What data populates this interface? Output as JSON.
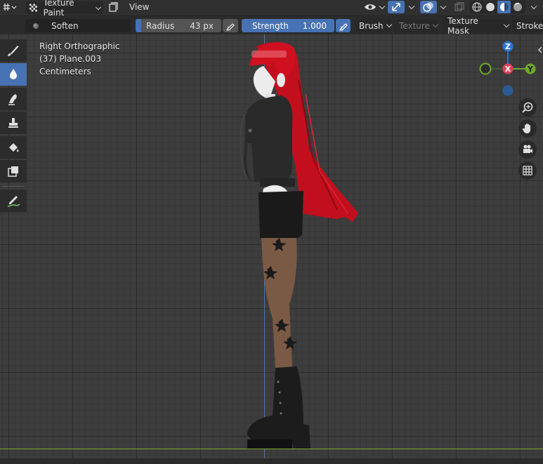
{
  "header": {
    "mode_label": "Texture Paint",
    "view_menu": "View",
    "colors": {
      "accent": "#4772b3",
      "header_bg": "#303030"
    },
    "icons": [
      "editor-type-icon",
      "texture-paint-icon",
      "view-toggle-icon",
      "visibility-icon",
      "gizmo-icon",
      "overlay-icon",
      "xray-icon",
      "shading-wireframe-icon",
      "shading-solid-icon",
      "shading-material-icon",
      "shading-rendered-icon"
    ]
  },
  "tool_settings": {
    "brush_name": "Soften",
    "radius_label": "Radius",
    "radius_value": "43 px",
    "strength_label": "Strength",
    "strength_value": "1.000",
    "brush_menu": "Brush",
    "texture_menu": "Texture",
    "texture_mask_menu": "Texture Mask",
    "stroke_menu": "Stroke"
  },
  "viewport": {
    "view_name": "Right Orthographic",
    "object_name": "(37) Plane.003",
    "units": "Centimeters",
    "gizmo_axes": {
      "z": "Z",
      "x": "X",
      "y": "Y"
    }
  },
  "toolbar": {
    "tools": [
      "draw-tool",
      "soften-tool",
      "smear-tool",
      "clone-tool",
      "fill-tool",
      "mask-tool",
      "annotate-tool"
    ],
    "active_tool": "soften-tool"
  }
}
